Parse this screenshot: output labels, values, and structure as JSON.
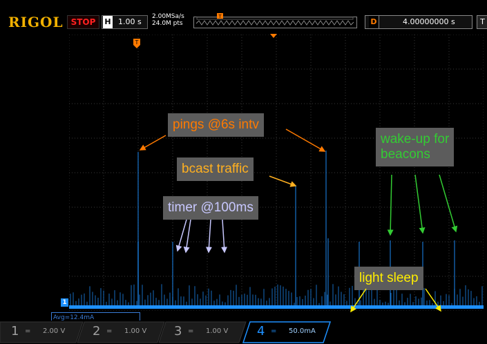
{
  "header": {
    "brand": "RIGOL",
    "run_status": "STOP",
    "horizontal": {
      "key": "H",
      "value": "1.00 s"
    },
    "sample_rate": "2.00MSa/s",
    "memory_depth": "24.0M pts",
    "delay": {
      "key": "D",
      "value": "4.00000000 s"
    },
    "trigger_corner": "T"
  },
  "annotations": {
    "pings": "pings @6s intv",
    "bcast": "bcast traffic",
    "timer": "timer @100ms",
    "wake_line1": "wake-up for",
    "wake_line2": "beacons",
    "light_sleep": "light sleep"
  },
  "trigger_marker": "T",
  "ch_marker": "1",
  "avg_label": "Avg=12.4mA",
  "channels": [
    {
      "num": "1",
      "coupling": "=",
      "scale": "2.00 V",
      "color": "#a0a0a0"
    },
    {
      "num": "2",
      "coupling": "=",
      "scale": "1.00 V",
      "color": "#a0a0a0"
    },
    {
      "num": "3",
      "coupling": "=",
      "scale": "1.00 V",
      "color": "#a0a0a0"
    },
    {
      "num": "4",
      "coupling": "=",
      "scale": "50.0mA",
      "color": "#1e90ff"
    }
  ],
  "colors": {
    "trace": "#1e90ff",
    "brand": "#f2b100",
    "pings_text": "#ff7a00",
    "bcast_text": "#ffb020",
    "timer_text": "#c8c8ff",
    "wake_text": "#33cc33",
    "sleep_text": "#ffee00"
  }
}
